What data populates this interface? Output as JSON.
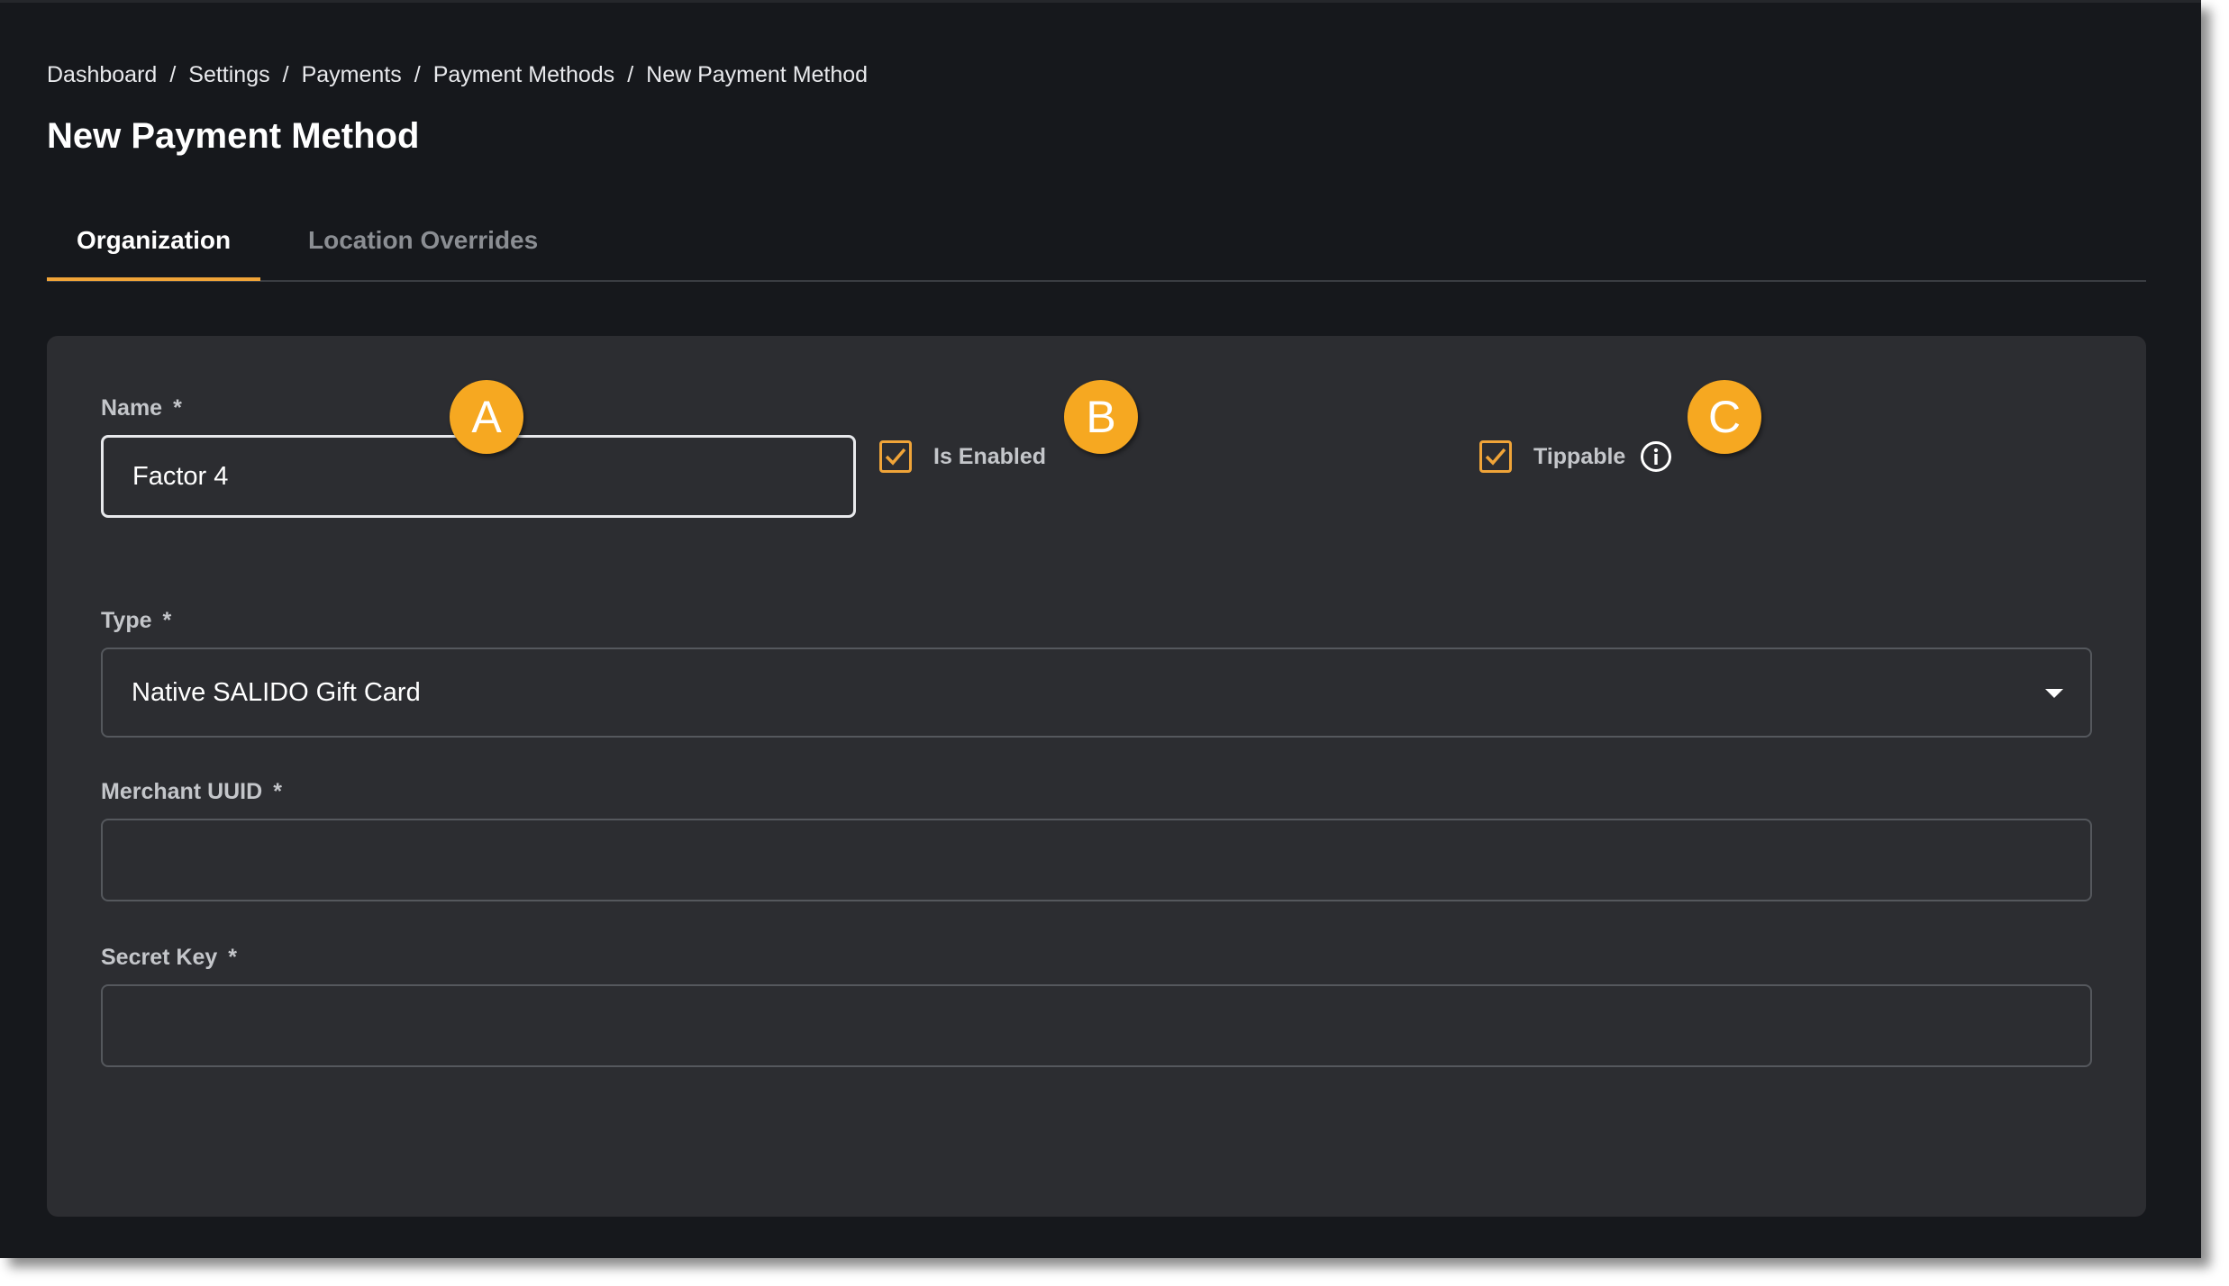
{
  "breadcrumb": {
    "items": [
      "Dashboard",
      "Settings",
      "Payments",
      "Payment Methods",
      "New Payment Method"
    ],
    "separator": "/"
  },
  "page": {
    "title": "New Payment Method"
  },
  "tabs": [
    {
      "label": "Organization",
      "active": true
    },
    {
      "label": "Location Overrides",
      "active": false
    }
  ],
  "form": {
    "name": {
      "label": "Name",
      "required_mark": "*",
      "value": "Factor 4"
    },
    "is_enabled": {
      "label": "Is Enabled",
      "checked": true
    },
    "tippable": {
      "label": "Tippable",
      "checked": true,
      "icon": "info-icon"
    },
    "type": {
      "label": "Type",
      "required_mark": "*",
      "value": "Native SALIDO Gift Card"
    },
    "merchant_uuid": {
      "label": "Merchant UUID",
      "required_mark": "*",
      "value": ""
    },
    "secret_key": {
      "label": "Secret Key",
      "required_mark": "*",
      "value": ""
    }
  },
  "annotations": {
    "a": "A",
    "b": "B",
    "c": "C"
  },
  "colors": {
    "background": "#16181c",
    "card": "#2c2d31",
    "accent": "#f0a438",
    "marker": "#f6a821"
  }
}
